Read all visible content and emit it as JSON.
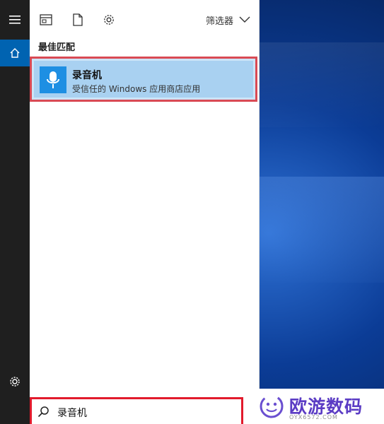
{
  "toolbar": {
    "filter_label": "筛选器",
    "icons": [
      "apps-icon",
      "document-icon",
      "settings-icon",
      "chevron-down-icon"
    ]
  },
  "rail": {
    "icons": [
      "hamburger-menu-icon",
      "home-icon",
      "gear-icon"
    ]
  },
  "results": {
    "section_title": "最佳匹配",
    "best_match": {
      "name": "录音机",
      "subtitle": "受信任的 Windows 应用商店应用",
      "icon": "voice-recorder-icon"
    }
  },
  "search": {
    "value": "录音机",
    "icon": "search-icon"
  },
  "watermark": {
    "text": "欧游数码",
    "small": "OYX6572.COM"
  },
  "colors": {
    "rail_bg": "#1f1f1f",
    "home_accent": "#0063b1",
    "result_bg": "#a9d1f1",
    "highlight_red": "#e21a2c",
    "app_tile": "#1e8fe3"
  }
}
